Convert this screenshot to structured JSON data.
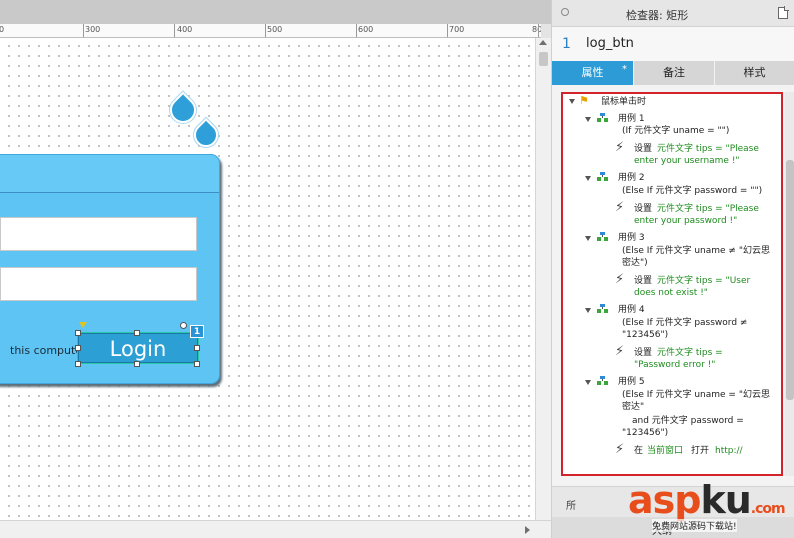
{
  "ruler": {
    "labels": [
      "0",
      "300",
      "400",
      "500",
      "600",
      "700",
      "80"
    ]
  },
  "canvas": {
    "login_panel": {
      "remember_text": "this computer",
      "login_label": "Login",
      "badge": "1"
    }
  },
  "inspector": {
    "title": "检查器: 矩形",
    "widget_number": "1",
    "widget_name": "log_btn",
    "tabs": [
      {
        "label": "属性",
        "marker": "*",
        "active": true
      },
      {
        "label": "备注",
        "active": false
      },
      {
        "label": "样式",
        "active": false
      }
    ],
    "event": {
      "name": "鼠标单击时",
      "cases": [
        {
          "title": "用例 1",
          "condition_lines": [
            "(If 元件文字 uname = \"\")"
          ],
          "action_prefix": "设置",
          "action_lines": [
            "元件文字 tips = \"Please",
            "enter your username !\""
          ]
        },
        {
          "title": "用例 2",
          "condition_lines": [
            "(Else If 元件文字 password = \"\")"
          ],
          "action_prefix": "设置",
          "action_lines": [
            "元件文字 tips = \"Please",
            "enter your password !\""
          ]
        },
        {
          "title": "用例 3",
          "condition_lines": [
            "(Else If 元件文字 uname ≠ \"幻云思",
            "密达\")"
          ],
          "action_prefix": "设置",
          "action_lines": [
            "元件文字 tips = \"User",
            "does not exist !\""
          ]
        },
        {
          "title": "用例 4",
          "condition_lines": [
            "(Else If 元件文字 password ≠",
            "\"123456\")"
          ],
          "action_prefix": "设置",
          "action_lines": [
            "元件文字 tips =",
            "\"Password error !\""
          ]
        },
        {
          "title": "用例 5",
          "condition_lines": [
            "(Else If 元件文字 uname = \"幻云思",
            "密达\"",
            "and 元件文字 password =",
            "\"123456\")"
          ],
          "action_prefix": "在",
          "action_green": "当前窗口",
          "action_suffix": "打开",
          "action_link": "http://"
        }
      ]
    },
    "bottom_text": "所",
    "bottom_bar_label": "大纲"
  },
  "watermark": {
    "brand_a": "asp",
    "brand_b": "ku",
    "brand_c": ".com",
    "tagline": "免费网站源码下载站!"
  }
}
